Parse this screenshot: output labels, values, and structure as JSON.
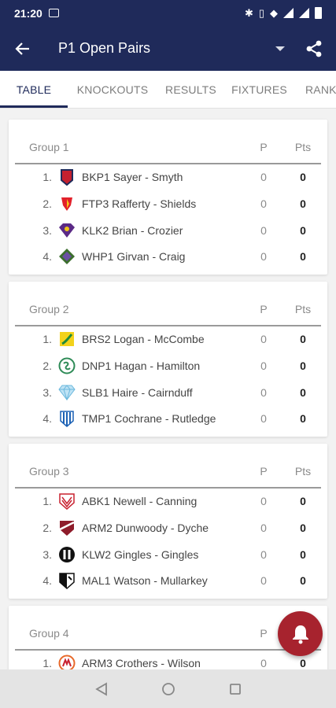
{
  "status": {
    "time": "21:20"
  },
  "header": {
    "title": "P1 Open Pairs"
  },
  "tabs": [
    {
      "label": "TABLE",
      "active": true
    },
    {
      "label": "KNOCKOUTS",
      "active": false
    },
    {
      "label": "RESULTS",
      "active": false
    },
    {
      "label": "FIXTURES",
      "active": false
    },
    {
      "label": "RANK",
      "active": false
    }
  ],
  "columns": {
    "played": "P",
    "points": "Pts"
  },
  "groups": [
    {
      "name": "Group 1",
      "rows": [
        {
          "pos": "1.",
          "team": "BKP1 Sayer - Smyth",
          "p": "0",
          "pts": "0",
          "crest": "shield-crest-icon"
        },
        {
          "pos": "2.",
          "team": "FTP3 Rafferty - Shields",
          "p": "0",
          "pts": "0",
          "crest": "red-yellow-crest-icon"
        },
        {
          "pos": "3.",
          "team": "KLK2 Brian - Crozier",
          "p": "0",
          "pts": "0",
          "crest": "purple-crest-icon"
        },
        {
          "pos": "4.",
          "team": "WHP1 Girvan - Craig",
          "p": "0",
          "pts": "0",
          "crest": "diamond-crest-icon"
        }
      ]
    },
    {
      "name": "Group 2",
      "rows": [
        {
          "pos": "1.",
          "team": "BRS2 Logan - McCombe",
          "p": "0",
          "pts": "0",
          "crest": "yellow-green-crest-icon"
        },
        {
          "pos": "2.",
          "team": "DNP1 Hagan - Hamilton",
          "p": "0",
          "pts": "0",
          "crest": "green-circle-crest-icon"
        },
        {
          "pos": "3.",
          "team": "SLB1 Haire - Cairnduff",
          "p": "0",
          "pts": "0",
          "crest": "gem-crest-icon"
        },
        {
          "pos": "4.",
          "team": "TMP1 Cochrane - Rutledge",
          "p": "0",
          "pts": "0",
          "crest": "blue-stripe-crest-icon"
        }
      ]
    },
    {
      "name": "Group 3",
      "rows": [
        {
          "pos": "1.",
          "team": "ABK1 Newell - Canning",
          "p": "0",
          "pts": "0",
          "crest": "red-white-crest-icon"
        },
        {
          "pos": "2.",
          "team": "ARM2 Dunwoody - Dyche",
          "p": "0",
          "pts": "0",
          "crest": "maroon-crest-icon"
        },
        {
          "pos": "3.",
          "team": "KLW2 Gingles - Gingles",
          "p": "0",
          "pts": "0",
          "crest": "black-circle-crest-icon"
        },
        {
          "pos": "4.",
          "team": "MAL1 Watson - Mullarkey",
          "p": "0",
          "pts": "0",
          "crest": "black-white-crest-icon"
        }
      ]
    },
    {
      "name": "Group 4",
      "rows": [
        {
          "pos": "1.",
          "team": "ARM3 Crothers - Wilson",
          "p": "0",
          "pts": "0",
          "crest": "orange-circle-crest-icon"
        }
      ]
    }
  ],
  "colors": {
    "primary": "#1f2a5a",
    "fab": "#a7232e"
  },
  "icons": {
    "back": "arrow-back-icon",
    "dropdown": "dropdown-arrow-icon",
    "share": "share-icon",
    "fab": "bell-icon"
  }
}
